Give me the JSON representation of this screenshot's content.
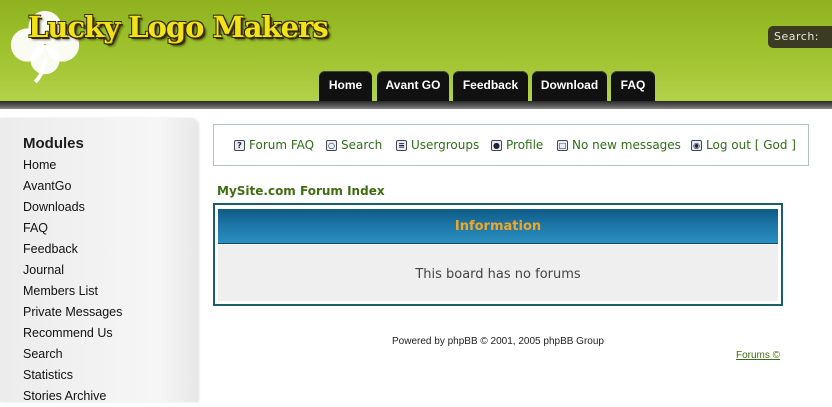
{
  "header": {
    "logo_text": "Lucky Logo Makers",
    "search_label": "Search:",
    "nav": [
      "Home",
      "Avant GO",
      "Feedback",
      "Download",
      "FAQ"
    ]
  },
  "sidebar": {
    "title": "Modules",
    "items": [
      "Home",
      "AvantGo",
      "Downloads",
      "FAQ",
      "Feedback",
      "Journal",
      "Members List",
      "Private Messages",
      "Recommend Us",
      "Search",
      "Statistics",
      "Stories Archive"
    ]
  },
  "forum_nav": [
    {
      "label": "Forum FAQ",
      "icon": "faq-icon"
    },
    {
      "label": "Search",
      "icon": "search-icon"
    },
    {
      "label": "Usergroups",
      "icon": "usergroups-icon"
    },
    {
      "label": "Profile",
      "icon": "profile-icon"
    },
    {
      "label": "No new messages",
      "icon": "messages-icon"
    },
    {
      "label": "Log out [ God ]",
      "icon": "logout-icon"
    }
  ],
  "forum_index_link": "MySite.com Forum Index",
  "info": {
    "header": "Information",
    "message": "This board has no forums"
  },
  "footer": {
    "powered_by": "Powered by phpBB © 2001, 2005 phpBB Group",
    "forums_link": "Forums ©"
  },
  "colors": {
    "header_green": "#9bc02a",
    "logo_yellow": "#f2e21a",
    "nav_black": "#111111",
    "link_green": "#3f6e10",
    "info_blue": "#1d78a8",
    "info_orange": "#f5a623"
  }
}
